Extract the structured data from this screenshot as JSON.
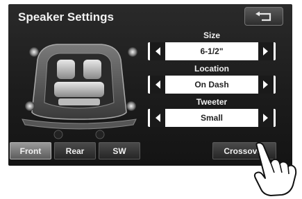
{
  "header": {
    "title": "Speaker Settings",
    "back_icon": "return-arrow-icon"
  },
  "settings": [
    {
      "label": "Size",
      "value": "6-1/2\""
    },
    {
      "label": "Location",
      "value": "On Dash"
    },
    {
      "label": "Tweeter",
      "value": "Small"
    }
  ],
  "tabs": {
    "front": "Front",
    "rear": "Rear",
    "sw": "SW"
  },
  "crossover_label": "Crossover",
  "colors": {
    "screen_bg": "#1c1c1c",
    "selector_bg": "#ffffff",
    "text": "#f0f0f0"
  }
}
